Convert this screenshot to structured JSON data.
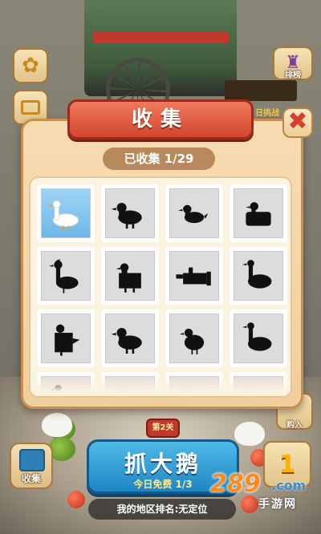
{
  "modal": {
    "title": "收集",
    "collected": "已收集 1/29",
    "close_glyph": "✖"
  },
  "grid": {
    "items": [
      {
        "state": "unlocked",
        "shape": "goose-icon"
      },
      {
        "state": "locked",
        "shape": "duck-silhouette-icon"
      },
      {
        "state": "locked",
        "shape": "small-duck-silhouette-icon"
      },
      {
        "state": "locked",
        "shape": "boxed-duck-silhouette-icon"
      },
      {
        "state": "locked",
        "shape": "crested-goose-silhouette-icon"
      },
      {
        "state": "locked",
        "shape": "square-duck-silhouette-icon"
      },
      {
        "state": "locked",
        "shape": "box-goose-silhouette-icon"
      },
      {
        "state": "locked",
        "shape": "goose-silhouette-icon"
      },
      {
        "state": "locked",
        "shape": "block-duck-silhouette-icon"
      },
      {
        "state": "locked",
        "shape": "duck-silhouette-icon"
      },
      {
        "state": "locked",
        "shape": "round-duck-silhouette-icon"
      },
      {
        "state": "locked",
        "shape": "goose-silhouette-icon"
      },
      {
        "state": "locked",
        "shape": "goose-silhouette-icon"
      },
      {
        "state": "locked",
        "shape": "duck-silhouette-icon"
      },
      {
        "state": "locked",
        "shape": "duck-silhouette-icon"
      },
      {
        "state": "locked",
        "shape": "duck-silhouette-icon"
      }
    ]
  },
  "sidebar": {
    "rank_label": "排榜",
    "buy_label": "购入",
    "collect_label": "收集",
    "reward_digit": "1"
  },
  "scene": {
    "plate_text": "日挑战"
  },
  "main": {
    "grab_title": "抓大鹅",
    "grab_sub": "今日免费 1/3",
    "level_tag": "第2关",
    "rank_text": "我的地区排名:无定位"
  },
  "watermark": {
    "num": "289",
    "com": ".com",
    "cn": "手游网"
  },
  "colors": {
    "banner": "#d2452f",
    "panel": "#f1cf9c",
    "grab_button": "#1f86c4",
    "close_x": "#d6402a"
  }
}
